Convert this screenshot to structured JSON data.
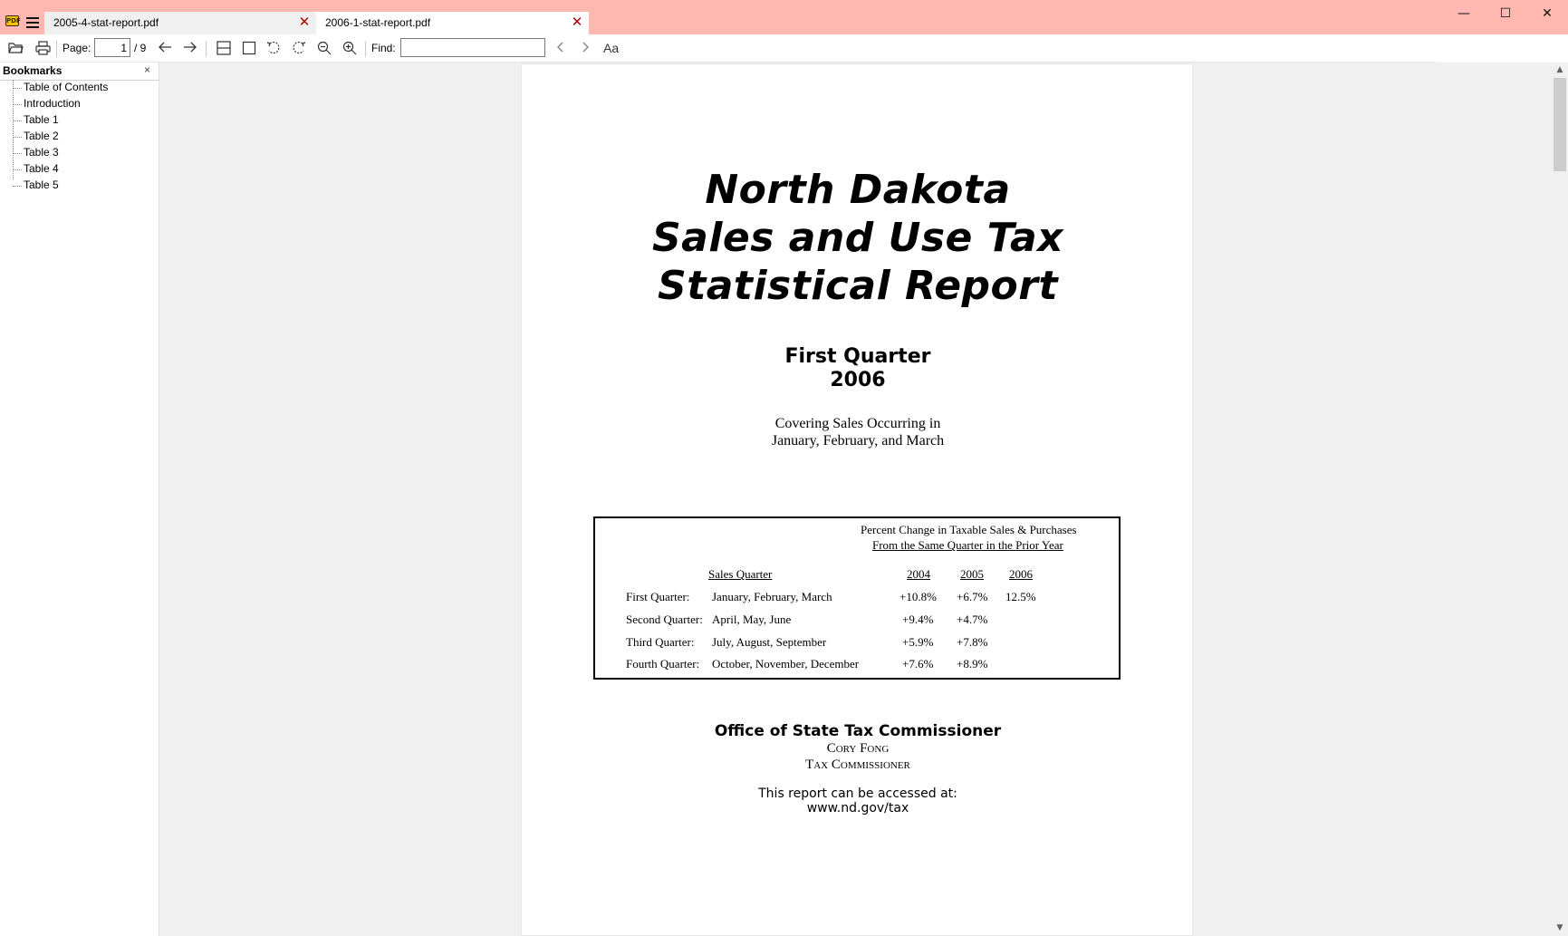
{
  "window": {
    "tabs": [
      {
        "label": "2005-4-stat-report.pdf"
      },
      {
        "label": "2006-1-stat-report.pdf"
      }
    ],
    "tab_close_glyph": "✕",
    "controls": {
      "minimize": "—",
      "maximize": "☐",
      "close": "✕"
    }
  },
  "toolbar": {
    "page_label": "Page:",
    "page_current": "1",
    "page_total": "/ 9",
    "find_label": "Find:",
    "find_value": "",
    "match_case_label": "Aa"
  },
  "sidebar": {
    "title": "Bookmarks",
    "close_glyph": "×",
    "items": [
      {
        "label": "Table of Contents"
      },
      {
        "label": "Introduction"
      },
      {
        "label": "Table 1"
      },
      {
        "label": "Table 2"
      },
      {
        "label": "Table 3"
      },
      {
        "label": "Table 4"
      },
      {
        "label": "Table 5"
      }
    ]
  },
  "document": {
    "title_lines": [
      "North Dakota",
      "Sales and Use Tax",
      "Statistical Report"
    ],
    "quarter_lines": [
      "First Quarter",
      "2006"
    ],
    "covering_lines": [
      "Covering Sales Occurring in",
      "January, February, and March"
    ],
    "pct_box": {
      "heading_line1": "Percent Change in Taxable Sales & Purchases",
      "heading_line2": "From the Same Quarter in the Prior Year",
      "col_sales_quarter": "Sales Quarter",
      "years": [
        "2004",
        "2005",
        "2006"
      ],
      "rows": [
        {
          "quarter": "First Quarter:",
          "months": "January, February, March",
          "v2004": "+10.8%",
          "v2005": "+6.7%",
          "v2006": "12.5%"
        },
        {
          "quarter": "Second Quarter:",
          "months": "April, May, June",
          "v2004": "+9.4%",
          "v2005": "+4.7%",
          "v2006": ""
        },
        {
          "quarter": "Third Quarter:",
          "months": "July, August, September",
          "v2004": "+5.9%",
          "v2005": "+7.8%",
          "v2006": ""
        },
        {
          "quarter": "Fourth Quarter:",
          "months": "October, November, December",
          "v2004": "+7.6%",
          "v2005": "+8.9%",
          "v2006": ""
        }
      ]
    },
    "office": "Office of State Tax Commissioner",
    "commissioner_name": "Cory Fong",
    "commissioner_title": "Tax Commissioner",
    "access_line": "This report can be accessed at:",
    "url": "www.nd.gov/tax"
  },
  "colors": {
    "titlebar": "#ffb8b0",
    "active_tab": "#ffffff",
    "inactive_tab": "#f0f0f0",
    "tab_close": "#b00000",
    "doc_background": "#f0f0f0"
  }
}
